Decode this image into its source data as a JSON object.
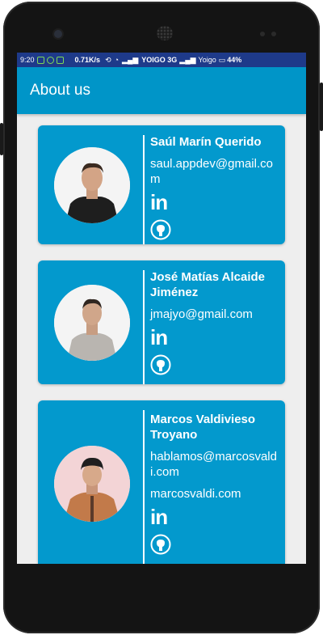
{
  "status_bar": {
    "time": "9:20",
    "speed": "0.71K/s",
    "carrier1": "YOIGO 3G",
    "carrier2": "Yoigo",
    "battery": "44%"
  },
  "appbar": {
    "title": "About us"
  },
  "team": [
    {
      "name": "Saúl Marín Querido",
      "email": "saul.appdev@gmail.com",
      "linkedin": "in"
    },
    {
      "name": "José Matías Alcaide Jiménez",
      "email": "jmajyo@gmail.com",
      "linkedin": "in"
    },
    {
      "name": "Marcos Valdivieso Troyano",
      "email": "hablamos@marcosvaldi.com",
      "website": "marcosvaldi.com",
      "linkedin": "in"
    }
  ]
}
